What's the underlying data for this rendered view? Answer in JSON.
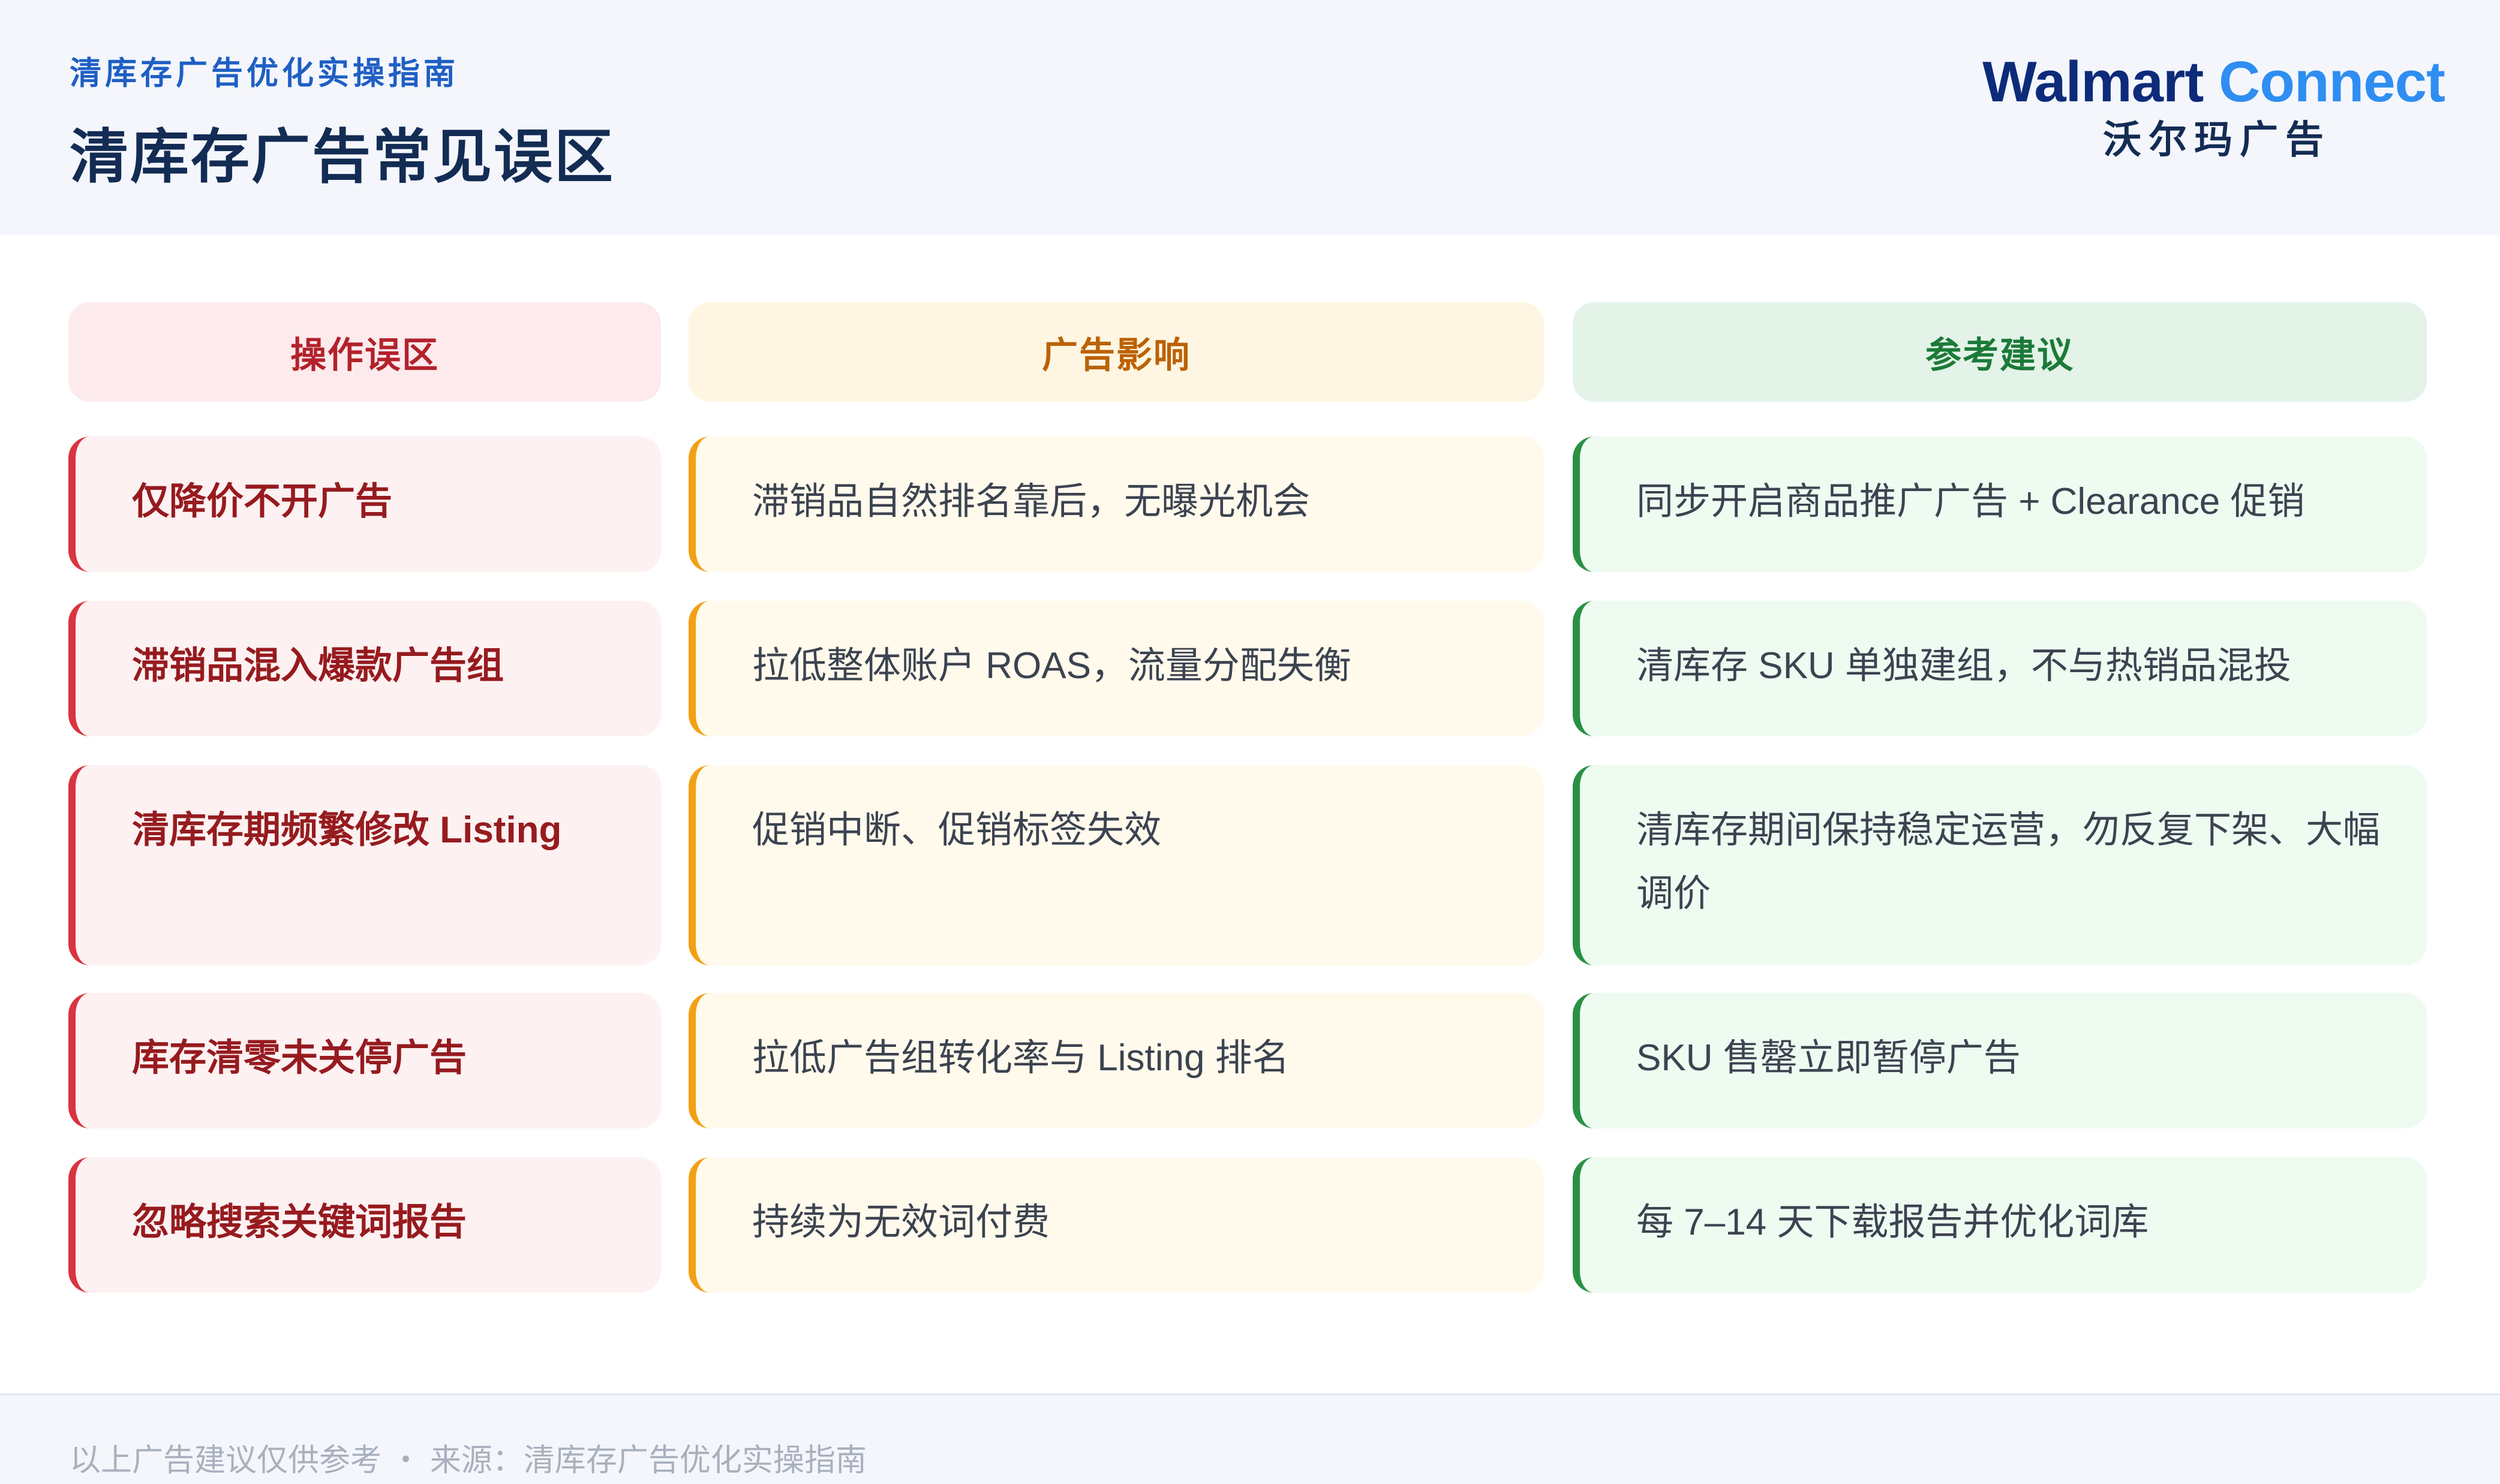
{
  "header": {
    "subtitle": "清库存广告优化实操指南",
    "title": "清库存广告常见误区",
    "logo": {
      "walmart": "Walmart",
      "connect": "Connect",
      "cn": "沃尔玛广告"
    }
  },
  "columns": [
    "操作误区",
    "广告影响",
    "参考建议"
  ],
  "rows": [
    {
      "mistake": "仅降价不开广告",
      "impact": "滞销品自然排名靠后，无曝光机会",
      "advice": "同步开启商品推广广告 + Clearance 促销"
    },
    {
      "mistake": "滞销品混入爆款广告组",
      "impact": "拉低整体账户 ROAS，流量分配失衡",
      "advice": "清库存 SKU 单独建组，不与热销品混投"
    },
    {
      "mistake": "清库存期频繁修改 Listing",
      "impact": "促销中断、促销标签失效",
      "advice": "清库存期间保持稳定运营，勿反复下架、大幅调价"
    },
    {
      "mistake": "库存清零未关停广告",
      "impact": "拉低广告组转化率与 Listing 排名",
      "advice": "SKU 售罄立即暂停广告"
    },
    {
      "mistake": "忽略搜索关键词报告",
      "impact": "持续为无效词付费",
      "advice": "每 7–14 天下载报告并优化词库"
    }
  ],
  "footer": {
    "note": "以上广告建议仅供参考 ・ 来源：清库存广告优化实操指南"
  },
  "colors": {
    "mistake_accent": "#d9343f",
    "impact_accent": "#f2a015",
    "advice_accent": "#2a9144",
    "brand_navy": "#0d2b7a",
    "brand_blue": "#2f8ef2"
  }
}
